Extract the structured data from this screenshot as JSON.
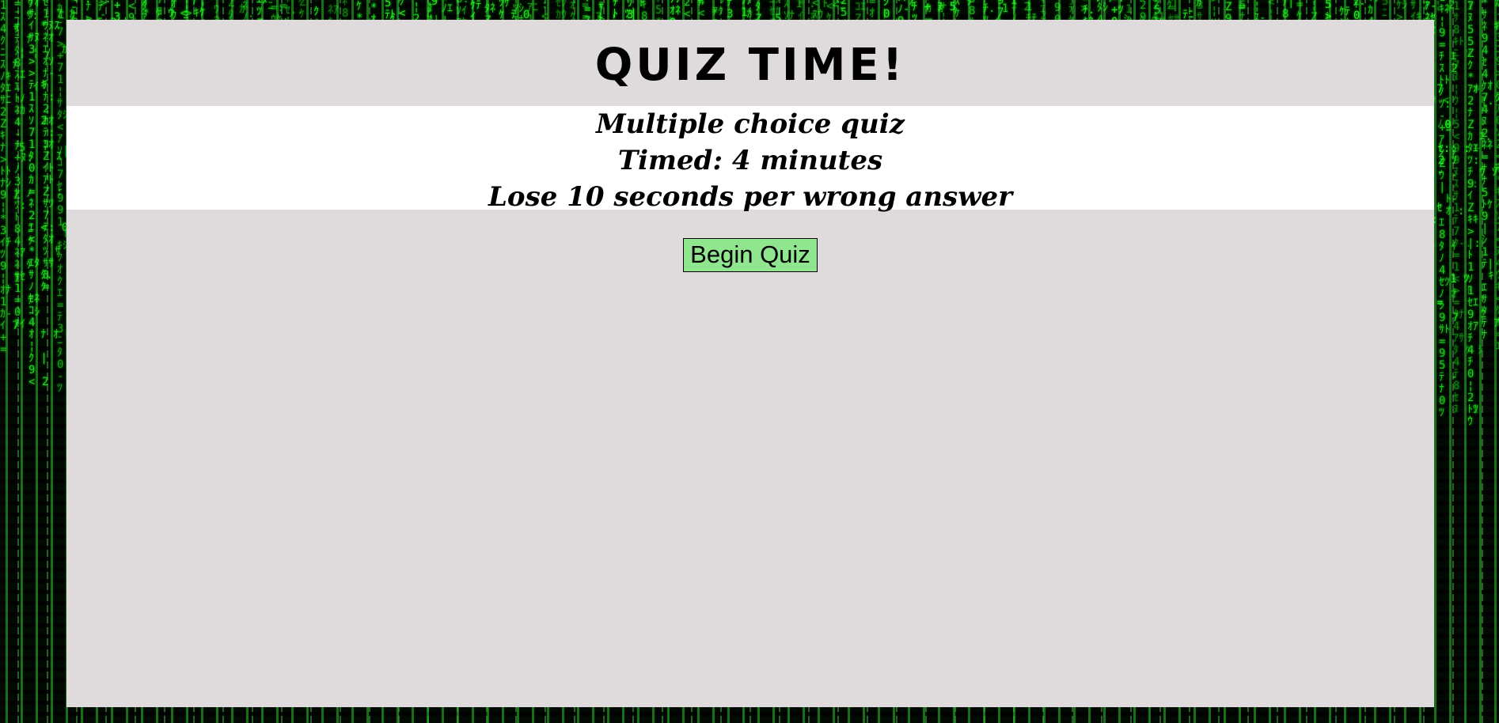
{
  "background": {
    "style": "matrix-digital-rain",
    "glyph_color": "#2cf02c",
    "base_color": "#020802"
  },
  "header": {
    "title": "QUIZ TIME!"
  },
  "intro": {
    "lines": [
      "Multiple choice quiz",
      "Timed: 4 minutes",
      "Lose 10 seconds per wrong answer"
    ]
  },
  "actions": {
    "begin_label": "Begin Quiz",
    "begin_color": "#8fe68f"
  },
  "colors": {
    "panel": "#dfdadb",
    "intro_band": "#ffffff"
  }
}
